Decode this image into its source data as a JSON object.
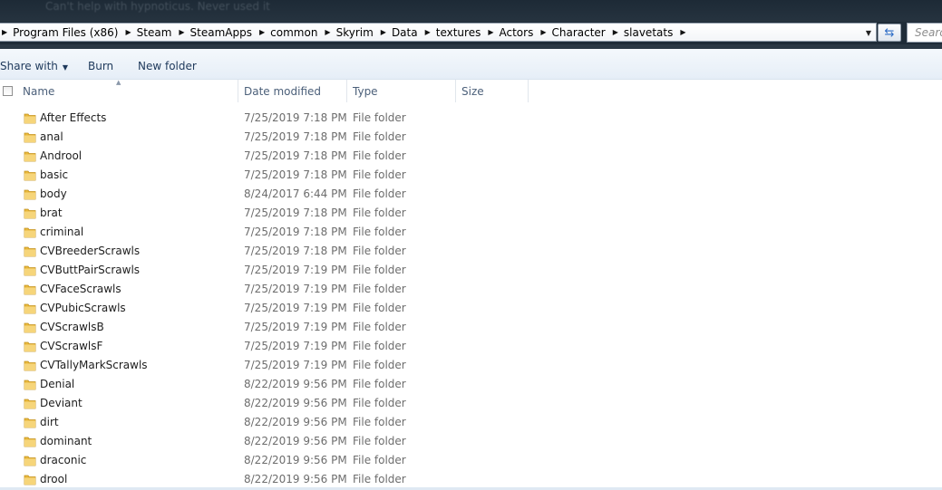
{
  "window": {
    "background_title": "Can't help with hypnoticus. Never used it"
  },
  "address_bar": {
    "breadcrumbs": [
      "Program Files (x86)",
      "Steam",
      "SteamApps",
      "common",
      "Skyrim",
      "Data",
      "textures",
      "Actors",
      "Character",
      "slavetats"
    ],
    "search_placeholder": "Search"
  },
  "toolbar": {
    "share_with": "Share with",
    "burn": "Burn",
    "new_folder": "New folder"
  },
  "columns": {
    "name": "Name",
    "date_modified": "Date modified",
    "type": "Type",
    "size": "Size"
  },
  "files": [
    {
      "name": "After Effects",
      "date": "7/25/2019 7:18 PM",
      "type": "File folder"
    },
    {
      "name": "anal",
      "date": "7/25/2019 7:18 PM",
      "type": "File folder"
    },
    {
      "name": "Androol",
      "date": "7/25/2019 7:18 PM",
      "type": "File folder"
    },
    {
      "name": "basic",
      "date": "7/25/2019 7:18 PM",
      "type": "File folder"
    },
    {
      "name": "body",
      "date": "8/24/2017 6:44 PM",
      "type": "File folder"
    },
    {
      "name": "brat",
      "date": "7/25/2019 7:18 PM",
      "type": "File folder"
    },
    {
      "name": "criminal",
      "date": "7/25/2019 7:18 PM",
      "type": "File folder"
    },
    {
      "name": "CVBreederScrawls",
      "date": "7/25/2019 7:18 PM",
      "type": "File folder"
    },
    {
      "name": "CVButtPairScrawls",
      "date": "7/25/2019 7:19 PM",
      "type": "File folder"
    },
    {
      "name": "CVFaceScrawls",
      "date": "7/25/2019 7:19 PM",
      "type": "File folder"
    },
    {
      "name": "CVPubicScrawls",
      "date": "7/25/2019 7:19 PM",
      "type": "File folder"
    },
    {
      "name": "CVScrawlsB",
      "date": "7/25/2019 7:19 PM",
      "type": "File folder"
    },
    {
      "name": "CVScrawlsF",
      "date": "7/25/2019 7:19 PM",
      "type": "File folder"
    },
    {
      "name": "CVTallyMarkScrawls",
      "date": "7/25/2019 7:19 PM",
      "type": "File folder"
    },
    {
      "name": "Denial",
      "date": "8/22/2019 9:56 PM",
      "type": "File folder"
    },
    {
      "name": "Deviant",
      "date": "8/22/2019 9:56 PM",
      "type": "File folder"
    },
    {
      "name": "dirt",
      "date": "8/22/2019 9:56 PM",
      "type": "File folder"
    },
    {
      "name": "dominant",
      "date": "8/22/2019 9:56 PM",
      "type": "File folder"
    },
    {
      "name": "draconic",
      "date": "8/22/2019 9:56 PM",
      "type": "File folder"
    },
    {
      "name": "drool",
      "date": "8/22/2019 9:56 PM",
      "type": "File folder"
    }
  ],
  "icons": {
    "folder": "folder-icon",
    "breadcrumb_separator": "chevron-right-icon",
    "refresh": "refresh-icon"
  },
  "colors": {
    "toolbar_text": "#1e395b",
    "header_text": "#4c607a",
    "folder": "#e8b83c"
  }
}
